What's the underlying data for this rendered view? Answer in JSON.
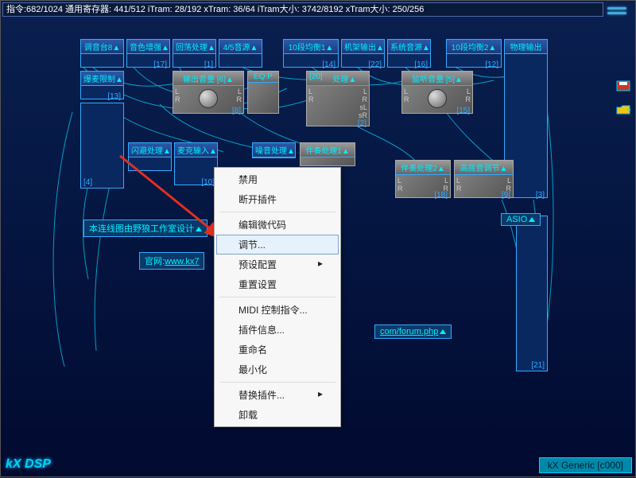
{
  "status": "指令:682/1024 通用寄存器: 441/512 iTram: 28/192 xTram: 36/64 iTram大小: 3742/8192 xTram大小: 250/256",
  "nodes": {
    "n1": {
      "title": "调音台8▲",
      "num": ""
    },
    "n2": {
      "title": "音色增强▲",
      "num": "[17]"
    },
    "n3": {
      "title": "回荡处理▲",
      "num": "[1]"
    },
    "n4": {
      "title": "4/5音源▲",
      "num": ""
    },
    "n5": {
      "title": "10段均衡1▲",
      "num": "[14]"
    },
    "n6": {
      "title": "机架输出▲",
      "num": "[22]"
    },
    "n7": {
      "title": "系统音源▲",
      "num": "[16]"
    },
    "n8": {
      "title": "10段均衡2▲",
      "num": "[12]"
    },
    "n9": {
      "title": "物理输出"
    },
    "n10": {
      "title": "爆麦限制▲",
      "num": "[13]"
    },
    "n11": {
      "title": "输出音量 [6]▲",
      "num": "[8]"
    },
    "n12": {
      "title": "EQ P",
      "num": ""
    },
    "n13": {
      "title": "处理▲",
      "num": "[20]",
      "subnum": "[2]"
    },
    "n14": {
      "title": "监听音量 [5]▲",
      "num": "[15]"
    },
    "n15": {
      "title": "闪避处理▲",
      "num": ""
    },
    "n16": {
      "title": "麦克输入▲",
      "num": "[10]"
    },
    "n17": {
      "title": "噪音处理▲",
      "num": ""
    },
    "n18": {
      "title": "伴奏处理1▲",
      "num": ""
    },
    "n19": {
      "title": "伴奏处理2▲",
      "num": "[18]"
    },
    "n20": {
      "title": "高底音调节▲",
      "num": "[9]"
    },
    "n21": {
      "title": "",
      "num": "[4]"
    },
    "n22": {
      "title": "",
      "num": "[3]"
    },
    "n23": {
      "title": "",
      "num": "[21]"
    }
  },
  "text1": "本连线图由野狼工作室设计",
  "text2_label": "官网:",
  "text2_url": "www.kx7",
  "text3": "com/forum.php",
  "asio": "ASIO",
  "menu": {
    "m1": "禁用",
    "m2": "断开插件",
    "m3": "编辑微代码",
    "m4": "调节...",
    "m5": "预设配置",
    "m6": "重置设置",
    "m7": "MIDI 控制指令...",
    "m8": "插件信息...",
    "m9": "重命名",
    "m10": "最小化",
    "m11": "替换插件...",
    "m12": "卸载"
  },
  "brand": "kX DSP",
  "footer": "kX Generic [c000]"
}
